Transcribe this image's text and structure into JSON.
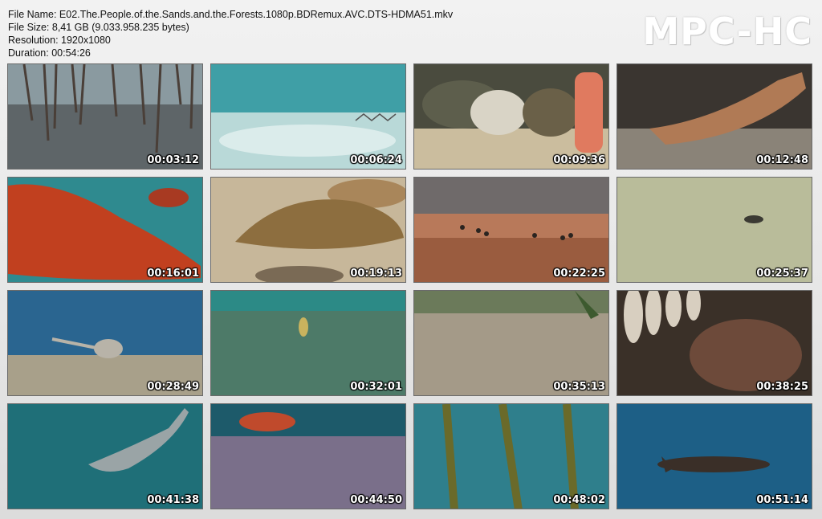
{
  "info": {
    "file_name": "File Name: E02.The.People.of.the.Sands.and.the.Forests.1080p.BDRemux.AVC.DTS-HDMA51.mkv",
    "file_size": "File Size: 8,41 GB (9.033.958.235 bytes)",
    "resolution": "Resolution: 1920x1080",
    "duration": "Duration: 00:54:26"
  },
  "logo": "MPC-HC",
  "thumbs": [
    {
      "time": "00:03:12"
    },
    {
      "time": "00:06:24"
    },
    {
      "time": "00:09:36"
    },
    {
      "time": "00:12:48"
    },
    {
      "time": "00:16:01"
    },
    {
      "time": "00:19:13"
    },
    {
      "time": "00:22:25"
    },
    {
      "time": "00:25:37"
    },
    {
      "time": "00:28:49"
    },
    {
      "time": "00:32:01"
    },
    {
      "time": "00:35:13"
    },
    {
      "time": "00:38:25"
    },
    {
      "time": "00:41:38"
    },
    {
      "time": "00:44:50"
    },
    {
      "time": "00:48:02"
    },
    {
      "time": "00:51:14"
    }
  ]
}
